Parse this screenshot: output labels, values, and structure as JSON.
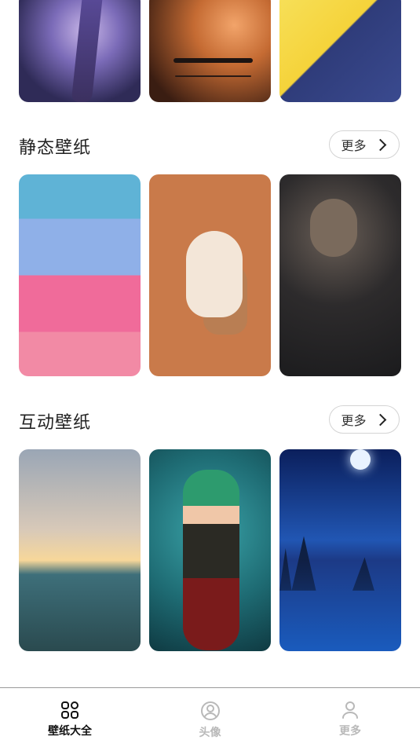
{
  "sections": [
    {
      "title": "静态壁纸",
      "more_label": "更多"
    },
    {
      "title": "互动壁纸",
      "more_label": "更多"
    }
  ],
  "bottom_nav": [
    {
      "label": "壁纸大全",
      "icon": "grid-icon",
      "active": true
    },
    {
      "label": "头像",
      "icon": "avatar-circle-icon",
      "active": false
    },
    {
      "label": "更多",
      "icon": "person-icon",
      "active": false
    }
  ]
}
